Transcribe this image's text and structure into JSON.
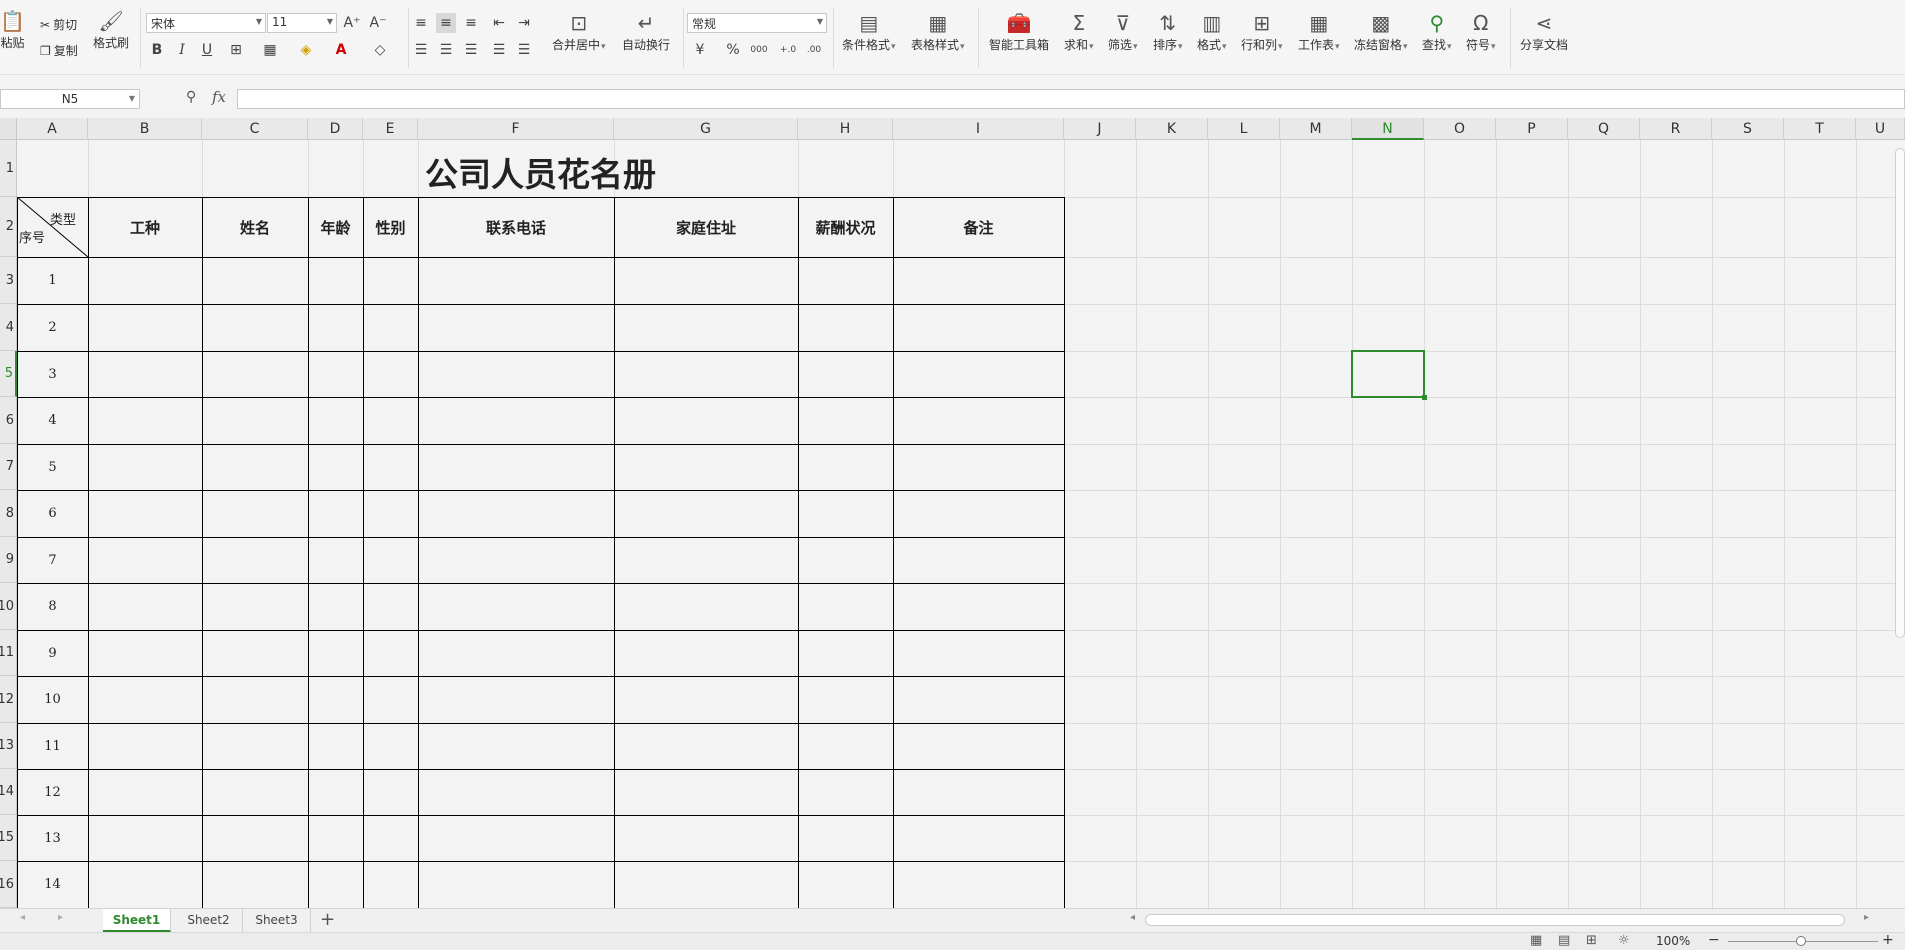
{
  "ribbon": {
    "paste": "粘贴",
    "cut": "剪切",
    "copy": "复制",
    "format_painter": "格式刷",
    "font_name": "宋体",
    "font_size": "11",
    "merge_center": "合并居中",
    "wrap_text": "自动换行",
    "number_format": "常规",
    "cond_format": "条件格式",
    "table_style": "表格样式",
    "smart_toolbox": "智能工具箱",
    "sum": "求和",
    "filter": "筛选",
    "sort": "排序",
    "format": "格式",
    "row_col": "行和列",
    "worksheet": "工作表",
    "freeze": "冻结窗格",
    "find": "查找",
    "symbol": "符号",
    "share": "分享文档",
    "bold": "B",
    "italic": "I",
    "underline": "U",
    "percent": "%",
    "thousands": "000",
    "inc_decimal": "+.0",
    "dec_decimal": ".00"
  },
  "formula_bar": {
    "name_box": "N5",
    "fx": "fx",
    "content": ""
  },
  "columns": [
    "A",
    "B",
    "C",
    "D",
    "E",
    "F",
    "G",
    "H",
    "I",
    "J",
    "K",
    "L",
    "M",
    "N",
    "O",
    "P",
    "Q",
    "R",
    "S",
    "T",
    "U"
  ],
  "selected_column": "N",
  "rows": [
    "1",
    "2",
    "3",
    "4",
    "5",
    "6",
    "7",
    "8",
    "9",
    "10",
    "11",
    "12",
    "13",
    "14",
    "15",
    "16"
  ],
  "selected_row": "5",
  "sheet": {
    "title": "公司人员花名册",
    "corner_top": "类型",
    "corner_bottom": "序号",
    "headers": [
      "工种",
      "姓名",
      "年龄",
      "性别",
      "联系电话",
      "家庭住址",
      "薪酬状况",
      "备注"
    ],
    "numbers": [
      "1",
      "2",
      "3",
      "4",
      "5",
      "6",
      "7",
      "8",
      "9",
      "10",
      "11",
      "12",
      "13",
      "14"
    ]
  },
  "tabs": [
    "Sheet1",
    "Sheet2",
    "Sheet3"
  ],
  "active_tab": "Sheet1",
  "add_tab": "+",
  "status": {
    "zoom": "100%",
    "zoom_out": "−",
    "zoom_in": "+"
  },
  "colors": {
    "accent": "#2e8b2e"
  }
}
